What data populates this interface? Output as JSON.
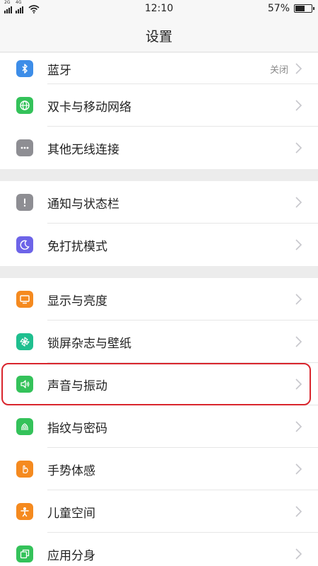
{
  "status_bar": {
    "sim1_label": "2G",
    "sim2_label": "4G",
    "time": "12:10",
    "battery": "57%",
    "battery_level": 0.57
  },
  "header": {
    "title": "设置"
  },
  "groups": [
    [
      {
        "label": "蓝牙",
        "value": "关闭",
        "icon": "bluetooth-icon",
        "color": "#3d8de8"
      },
      {
        "label": "双卡与移动网络",
        "value": "",
        "icon": "globe-icon",
        "color": "#34c25a"
      },
      {
        "label": "其他无线连接",
        "value": "",
        "icon": "more-icon",
        "color": "#8e8e93"
      }
    ],
    [
      {
        "label": "通知与状态栏",
        "value": "",
        "icon": "exclamation-icon",
        "color": "#8e8e93"
      },
      {
        "label": "免打扰模式",
        "value": "",
        "icon": "moon-icon",
        "color": "#6d64e8"
      }
    ],
    [
      {
        "label": "显示与亮度",
        "value": "",
        "icon": "display-icon",
        "color": "#f58a1f"
      },
      {
        "label": "锁屏杂志与壁纸",
        "value": "",
        "icon": "pinwheel-icon",
        "color": "#1fbf8f"
      },
      {
        "label": "声音与振动",
        "value": "",
        "icon": "speaker-icon",
        "color": "#34c25a"
      },
      {
        "label": "指纹与密码",
        "value": "",
        "icon": "fingerprint-icon",
        "color": "#34c25a"
      },
      {
        "label": "手势体感",
        "value": "",
        "icon": "hand-icon",
        "color": "#f58a1f"
      },
      {
        "label": "儿童空间",
        "value": "",
        "icon": "child-icon",
        "color": "#f58a1f"
      },
      {
        "label": "应用分身",
        "value": "",
        "icon": "app-clone-icon",
        "color": "#34c25a"
      }
    ]
  ],
  "highlight_color": "#d9252d"
}
